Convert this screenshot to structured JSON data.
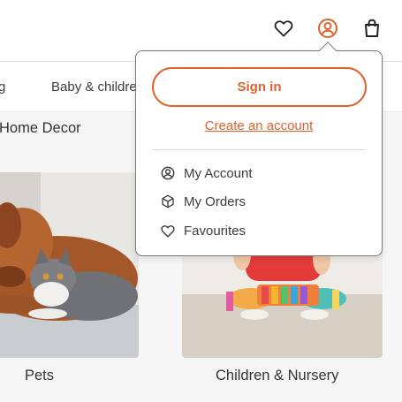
{
  "header": {
    "icons": {
      "wishlist": "heart-icon",
      "account": "user-circle-icon",
      "bag": "shopping-bag-icon"
    }
  },
  "category_nav": {
    "items": [
      {
        "label": "g"
      },
      {
        "label": "Baby & childre"
      }
    ]
  },
  "grid": {
    "top_left_title": "Home Decor",
    "tiles": [
      {
        "title": "Pets"
      },
      {
        "title": "Children & Nursery"
      }
    ]
  },
  "account_menu": {
    "sign_in_label": "Sign in",
    "create_account_label": "Create an account",
    "items": [
      {
        "label": "My Account",
        "icon": "user-circle-icon"
      },
      {
        "label": "My Orders",
        "icon": "box-icon"
      },
      {
        "label": "Favourites",
        "icon": "heart-icon"
      }
    ]
  },
  "colors": {
    "accent": "#e0622a",
    "text": "#3c3c3c"
  }
}
